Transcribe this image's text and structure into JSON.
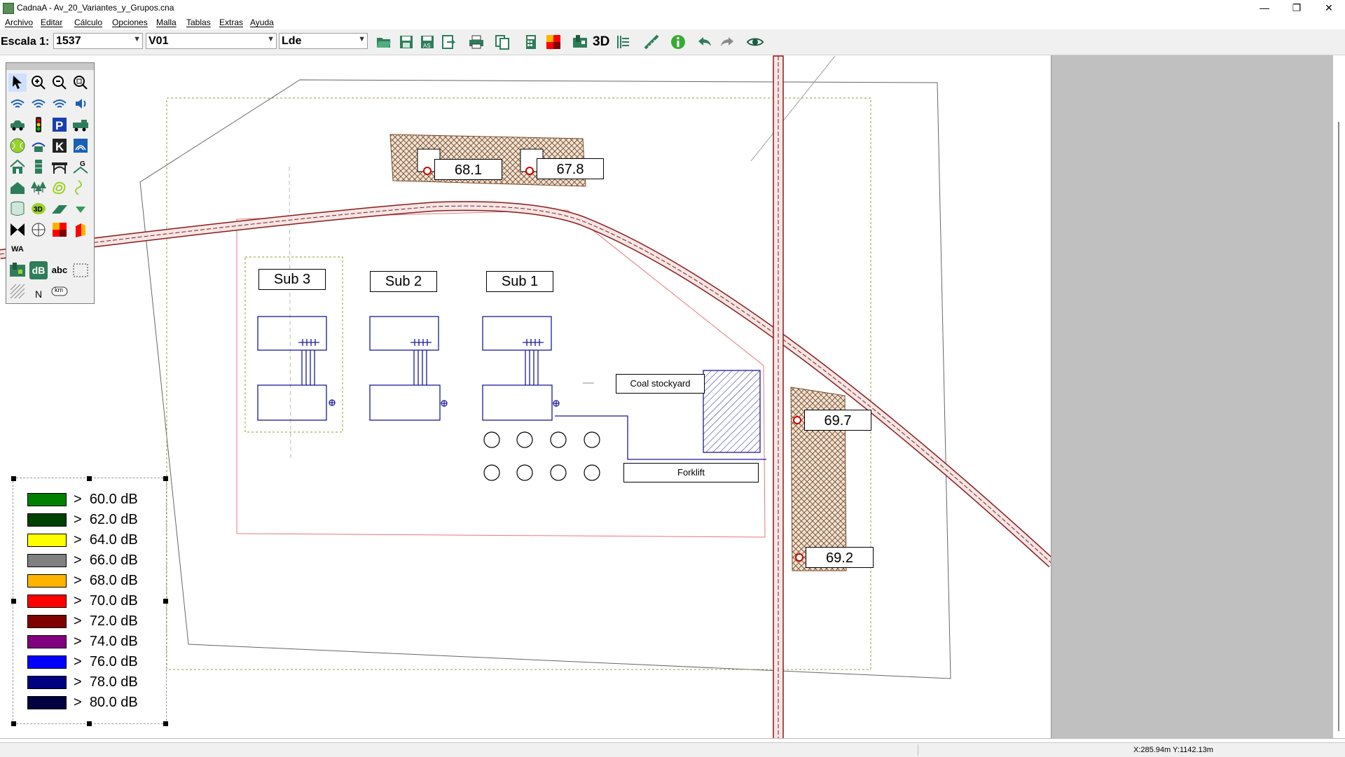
{
  "window": {
    "title": "CadnaA - Av_20_Variantes_y_Grupos.cna",
    "controls": [
      "—",
      "❐",
      "✕"
    ]
  },
  "menu": [
    "Archivo",
    "Editar",
    "Cálculo",
    "Opciones",
    "Malla",
    "Tablas",
    "Extras",
    "Ayuda"
  ],
  "toolbar": {
    "scale_label": "Escala 1:",
    "scale_value": "1537",
    "variant_value": "V01",
    "index_value": "Lde",
    "btn_3d": "3D"
  },
  "palette": {
    "wa_label": "WA",
    "db_label": "dB",
    "abc_label": "abc",
    "km_label": "km",
    "north_label": "N"
  },
  "map": {
    "receivers": [
      {
        "value": "68.1"
      },
      {
        "value": "67.8"
      },
      {
        "value": "69.7"
      },
      {
        "value": "69.2"
      }
    ],
    "substations": [
      "Sub 3",
      "Sub 2",
      "Sub 1"
    ],
    "labels": {
      "coal": "Coal stockyard",
      "forklift": "Forklift"
    }
  },
  "legend": {
    "entries": [
      {
        "symbol": ">",
        "value": "60.0 dB",
        "color": "#008000"
      },
      {
        "symbol": ">",
        "value": "62.0 dB",
        "color": "#004000"
      },
      {
        "symbol": ">",
        "value": "64.0 dB",
        "color": "#ffff00"
      },
      {
        "symbol": ">",
        "value": "66.0 dB",
        "color": "#808080"
      },
      {
        "symbol": ">",
        "value": "68.0 dB",
        "color": "#ffb400"
      },
      {
        "symbol": ">",
        "value": "70.0 dB",
        "color": "#ff0000"
      },
      {
        "symbol": ">",
        "value": "72.0 dB",
        "color": "#800000"
      },
      {
        "symbol": ">",
        "value": "74.0 dB",
        "color": "#800080"
      },
      {
        "symbol": ">",
        "value": "76.0 dB",
        "color": "#0000ff"
      },
      {
        "symbol": ">",
        "value": "78.0 dB",
        "color": "#000080"
      },
      {
        "symbol": ">",
        "value": "80.0 dB",
        "color": "#000040"
      }
    ]
  },
  "status": {
    "coords": "X:285.94m Y:1142.13m"
  }
}
